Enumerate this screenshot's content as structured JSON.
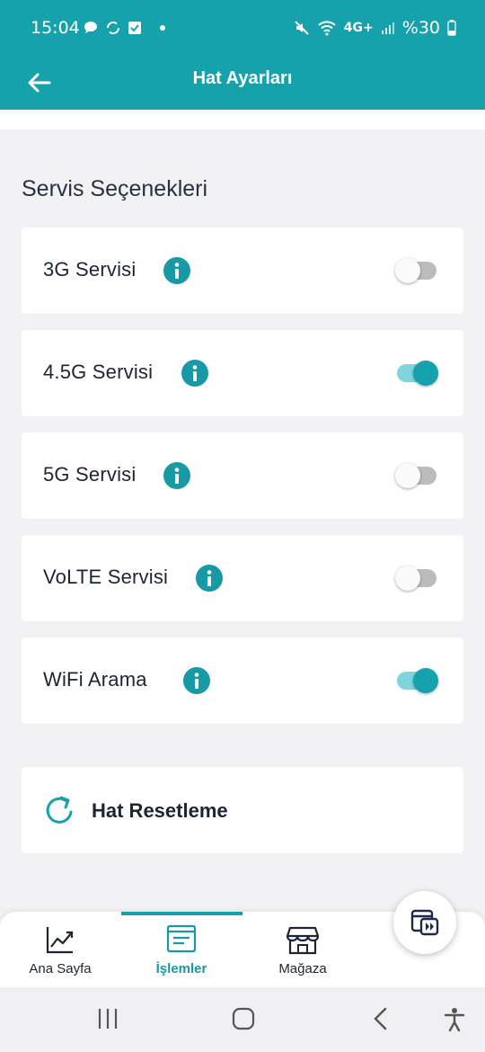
{
  "status_bar": {
    "time": "15:04",
    "battery": "%30",
    "network": "4G+",
    "icons_left": [
      "chat-bubble-icon",
      "sync-icon",
      "checkbox-icon",
      "dot"
    ],
    "icons_right": [
      "mute-icon",
      "wifi-icon",
      "network-icon",
      "signal-icon",
      "battery-icon"
    ]
  },
  "header": {
    "title": "Hat Ayarları"
  },
  "section": {
    "title": "Servis Seçenekleri"
  },
  "services": [
    {
      "label": "3G Servisi",
      "enabled": false
    },
    {
      "label": "4.5G Servisi",
      "enabled": true
    },
    {
      "label": "5G Servisi",
      "enabled": false
    },
    {
      "label": "VoLTE Servisi",
      "enabled": false
    },
    {
      "label": "WiFi Arama",
      "enabled": true
    }
  ],
  "reset": {
    "label": "Hat Resetleme"
  },
  "bottom_nav": {
    "items": [
      {
        "label": "Ana Sayfa",
        "icon": "chart-up-icon",
        "active": false
      },
      {
        "label": "İşlemler",
        "icon": "list-card-icon",
        "active": true
      },
      {
        "label": "Mağaza",
        "icon": "store-icon",
        "active": false
      }
    ],
    "fab_icon": "media-play-icon"
  },
  "colors": {
    "primary": "#16a2ad",
    "info": "#1799a6",
    "toggle_on_track": "#7fd5db",
    "toggle_off_track": "#bcbcbc",
    "background": "#f2f2f4",
    "text": "#1e2433"
  }
}
